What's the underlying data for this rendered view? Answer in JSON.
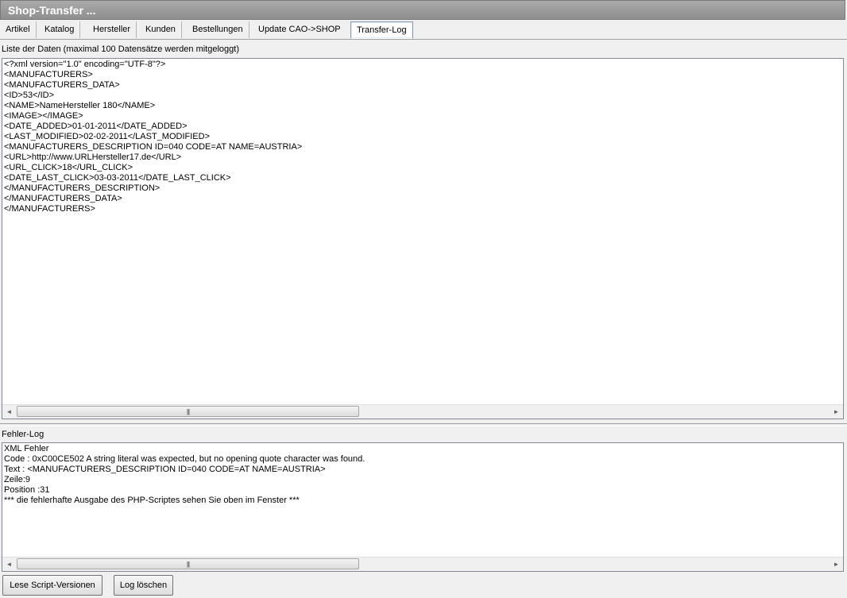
{
  "window": {
    "title": "Shop-Transfer ..."
  },
  "tabs": [
    {
      "label": "Artikel",
      "active": false
    },
    {
      "label": "Katalog",
      "active": false
    },
    {
      "label": "Hersteller",
      "active": false
    },
    {
      "label": "Kunden",
      "active": false
    },
    {
      "label": "Bestellungen",
      "active": false
    },
    {
      "label": "Update CAO->SHOP",
      "active": false
    },
    {
      "label": "Transfer-Log",
      "active": true
    }
  ],
  "data_section": {
    "label": "Liste der Daten (maximal 100 Datensätze werden mitgeloggt)",
    "content": "<?xml version=\"1.0\" encoding=\"UTF-8\"?>\n<MANUFACTURERS>\n<MANUFACTURERS_DATA>\n<ID>53</ID>\n<NAME>NameHersteller 180</NAME>\n<IMAGE></IMAGE>\n<DATE_ADDED>01-01-2011</DATE_ADDED>\n<LAST_MODIFIED>02-02-2011</LAST_MODIFIED>\n<MANUFACTURERS_DESCRIPTION ID=040 CODE=AT NAME=AUSTRIA>\n<URL>http://www.URLHersteller17.de</URL>\n<URL_CLICK>18</URL_CLICK>\n<DATE_LAST_CLICK>03-03-2011</DATE_LAST_CLICK>\n</MANUFACTURERS_DESCRIPTION>\n</MANUFACTURERS_DATA>\n</MANUFACTURERS>"
  },
  "error_section": {
    "label": "Fehler-Log",
    "content": "XML Fehler\nCode : 0xC00CE502 A string literal was expected, but no opening quote character was found.\nText : <MANUFACTURERS_DESCRIPTION ID=040 CODE=AT NAME=AUSTRIA>\nZeile:9\nPosition :31\n*** die fehlerhafte Ausgabe des PHP-Scriptes sehen Sie oben im Fenster ***"
  },
  "scrollbar": {
    "left_arrow": "◄",
    "right_arrow": "►",
    "grip": "|||"
  },
  "buttons": {
    "read_versions": "Lese Script-Versionen",
    "clear_log": "Log löschen"
  },
  "icons": {
    "scroll_left": "scroll-left-arrow-icon",
    "scroll_right": "scroll-right-arrow-icon"
  }
}
